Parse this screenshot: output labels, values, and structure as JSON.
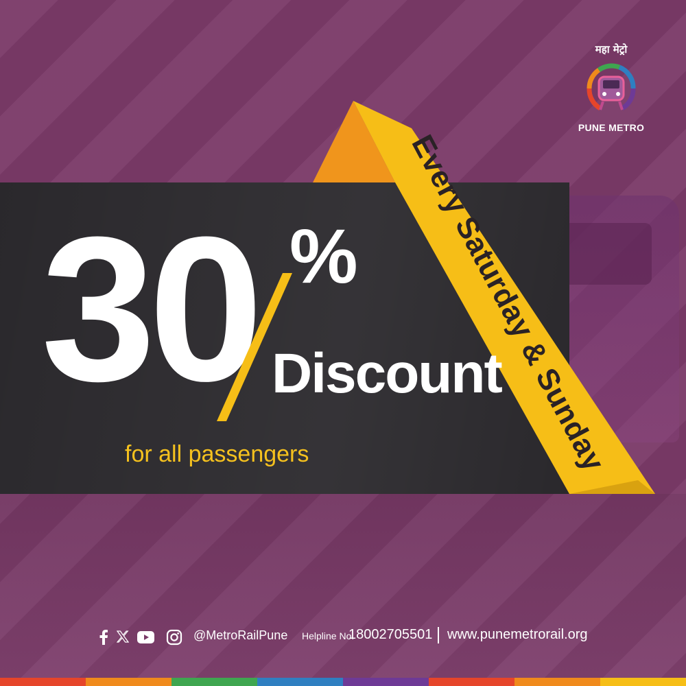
{
  "logo": {
    "marathi_text": "महा मेट्रो",
    "name": "PUNE METRO"
  },
  "headline": {
    "number": "30",
    "percent": "%",
    "word": "Discount",
    "subtitle": "for all passengers"
  },
  "ribbon": {
    "text": "Every Saturday & Sunday"
  },
  "footer": {
    "social_icons": [
      "facebook-icon",
      "x-icon",
      "youtube-icon",
      "instagram-icon"
    ],
    "handle": "@MetroRailPune",
    "helpline_label": "Helpline No.",
    "helpline_number": "18002705501",
    "separator": "|",
    "website": "www.punemetrorail.org"
  },
  "colors": {
    "background": "#7a3a68",
    "band": "#262428",
    "ribbon_yellow": "#f6be17",
    "ribbon_orange": "#f0951c",
    "accent_yellow": "#f5c11e",
    "bottom_bar": [
      "#e6452a",
      "#f08a1c",
      "#3fa650",
      "#2f7fc1",
      "#6e3a96",
      "#e6452a",
      "#f08a1c",
      "#f6be17"
    ]
  }
}
